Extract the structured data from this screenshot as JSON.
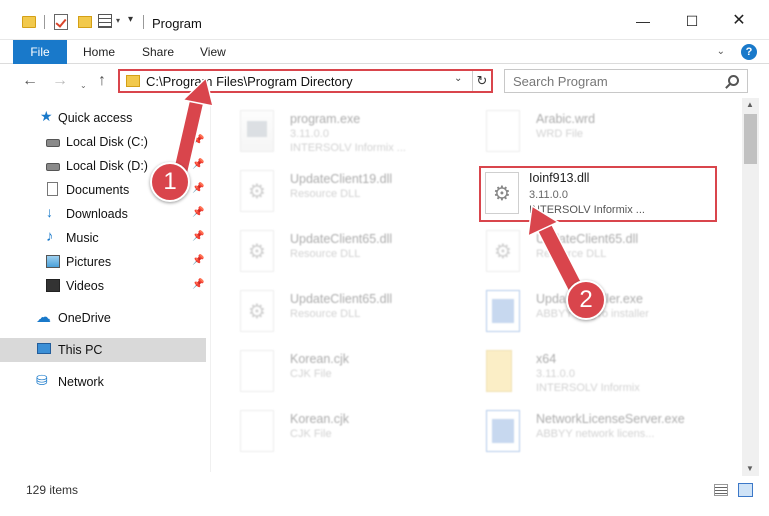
{
  "window": {
    "title": "Program",
    "minimize_glyph": "—",
    "maximize_glyph": "☐",
    "close_glyph": "✕"
  },
  "ribbon": {
    "tabs": [
      "File",
      "Home",
      "Share",
      "View"
    ],
    "expand_glyph": "⌄",
    "help_glyph": "?"
  },
  "nav": {
    "back_glyph": "←",
    "forward_glyph": "→",
    "history_glyph": "⌄",
    "up_glyph": "↑",
    "address": "C:\\Program Files\\Program Directory",
    "address_dropdown_glyph": "⌄",
    "refresh_glyph": "↻",
    "search_placeholder": "Search Program"
  },
  "sidebar": {
    "items": [
      {
        "label": "Quick access",
        "icon": "star-icon"
      },
      {
        "label": "Local Disk (C:)",
        "icon": "drive-icon",
        "pinned": true
      },
      {
        "label": "Local Disk (D:)",
        "icon": "drive-icon",
        "pinned": true
      },
      {
        "label": "Documents",
        "icon": "documents-icon",
        "pinned": true
      },
      {
        "label": "Downloads",
        "icon": "download-icon",
        "pinned": true
      },
      {
        "label": "Music",
        "icon": "music-icon",
        "pinned": true
      },
      {
        "label": "Pictures",
        "icon": "pictures-icon",
        "pinned": true
      },
      {
        "label": "Videos",
        "icon": "videos-icon",
        "pinned": true
      },
      {
        "label": "OneDrive",
        "icon": "cloud-icon"
      },
      {
        "label": "This PC",
        "icon": "computer-icon",
        "selected": true
      },
      {
        "label": "Network",
        "icon": "network-icon"
      }
    ]
  },
  "files": [
    {
      "name": "program.exe",
      "line1": "3.11.0.0",
      "line2": "INTERSOLV Informix ...",
      "icon": "exe"
    },
    {
      "name": "Arabic.wrd",
      "line1": "WRD File",
      "line2": "",
      "icon": "blank"
    },
    {
      "name": "UpdateClient19.dll",
      "line1": "Resource DLL",
      "line2": "",
      "icon": "dll"
    },
    {
      "name": "Ioinf913.dll",
      "line1": "3.11.0.0",
      "line2": "INTERSOLV Informix ...",
      "icon": "dll",
      "highlighted": true
    },
    {
      "name": "UpdateClient65.dll",
      "line1": "Resource DLL",
      "line2": "",
      "icon": "dll"
    },
    {
      "name": "UpdateClient65.dll",
      "line1": "Resource DLL",
      "line2": "",
      "icon": "dll"
    },
    {
      "name": "UpdateClient65.dll",
      "line1": "Resource DLL",
      "line2": "",
      "icon": "dll"
    },
    {
      "name": "UpdateInstaller.exe",
      "line1": "ABBYY Lingvo installer",
      "line2": "",
      "icon": "app"
    },
    {
      "name": "Korean.cjk",
      "line1": "CJK File",
      "line2": "",
      "icon": "blank"
    },
    {
      "name": "x64",
      "line1": "3.11.0.0",
      "line2": "INTERSOLV Informix",
      "icon": "folder"
    },
    {
      "name": "Korean.cjk",
      "line1": "CJK File",
      "line2": "",
      "icon": "blank"
    },
    {
      "name": "NetworkLicenseServer.exe",
      "line1": "ABBYY network licens...",
      "line2": "",
      "icon": "app"
    }
  ],
  "status": {
    "item_count": "129 items"
  },
  "annotations": {
    "step1": "1",
    "step2": "2",
    "accent": "#d9454c"
  },
  "colors": {
    "ribbon_file_tab": "#1979ca",
    "selected_nav": "#d9d9d9"
  }
}
